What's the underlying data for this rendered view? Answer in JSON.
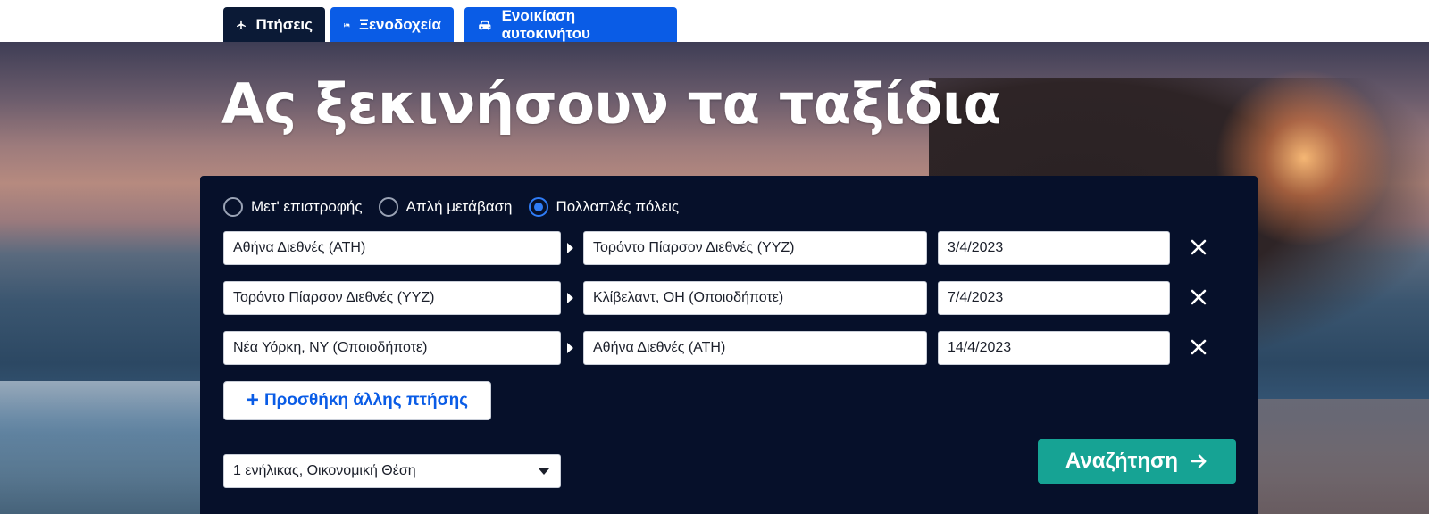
{
  "tabs": [
    {
      "label": "Πτήσεις",
      "icon": "plane-icon",
      "active": true
    },
    {
      "label": "Ξενοδοχεία",
      "icon": "bed-icon",
      "active": false
    },
    {
      "label": "Ενοικίαση αυτοκινήτου",
      "icon": "car-icon",
      "active": false
    }
  ],
  "hero": {
    "title": "Ας ξεκινήσουν τα ταξίδια"
  },
  "search": {
    "trip_types": [
      {
        "label": "Μετ' επιστροφής",
        "checked": false
      },
      {
        "label": "Απλή μετάβαση",
        "checked": false
      },
      {
        "label": "Πολλαπλές πόλεις",
        "checked": true
      }
    ],
    "legs": [
      {
        "from": "Αθήνα Διεθνές (ATH)",
        "to": "Τορόντο Πίαρσον Διεθνές (YYZ)",
        "date": "3/4/2023"
      },
      {
        "from": "Τορόντο Πίαρσον Διεθνές (YYZ)",
        "to": "Κλίβελαντ, OH (Οποιοδήποτε)",
        "date": "7/4/2023"
      },
      {
        "from": "Νέα Υόρκη, NY (Οποιοδήποτε)",
        "to": "Αθήνα Διεθνές (ATH)",
        "date": "14/4/2023"
      }
    ],
    "add_flight_label": "Προσθήκη άλλης πτήσης",
    "passengers": "1 ενήλικας, Οικονομική Θέση",
    "submit_label": "Αναζήτηση"
  },
  "colors": {
    "tab_active": "#0b1a36",
    "tab_inactive": "#0a5ce6",
    "panel_bg": "#06102a",
    "radio_checked": "#2f7cf6",
    "add_flight_text": "#0a5ce6",
    "search_button": "#16a394"
  }
}
